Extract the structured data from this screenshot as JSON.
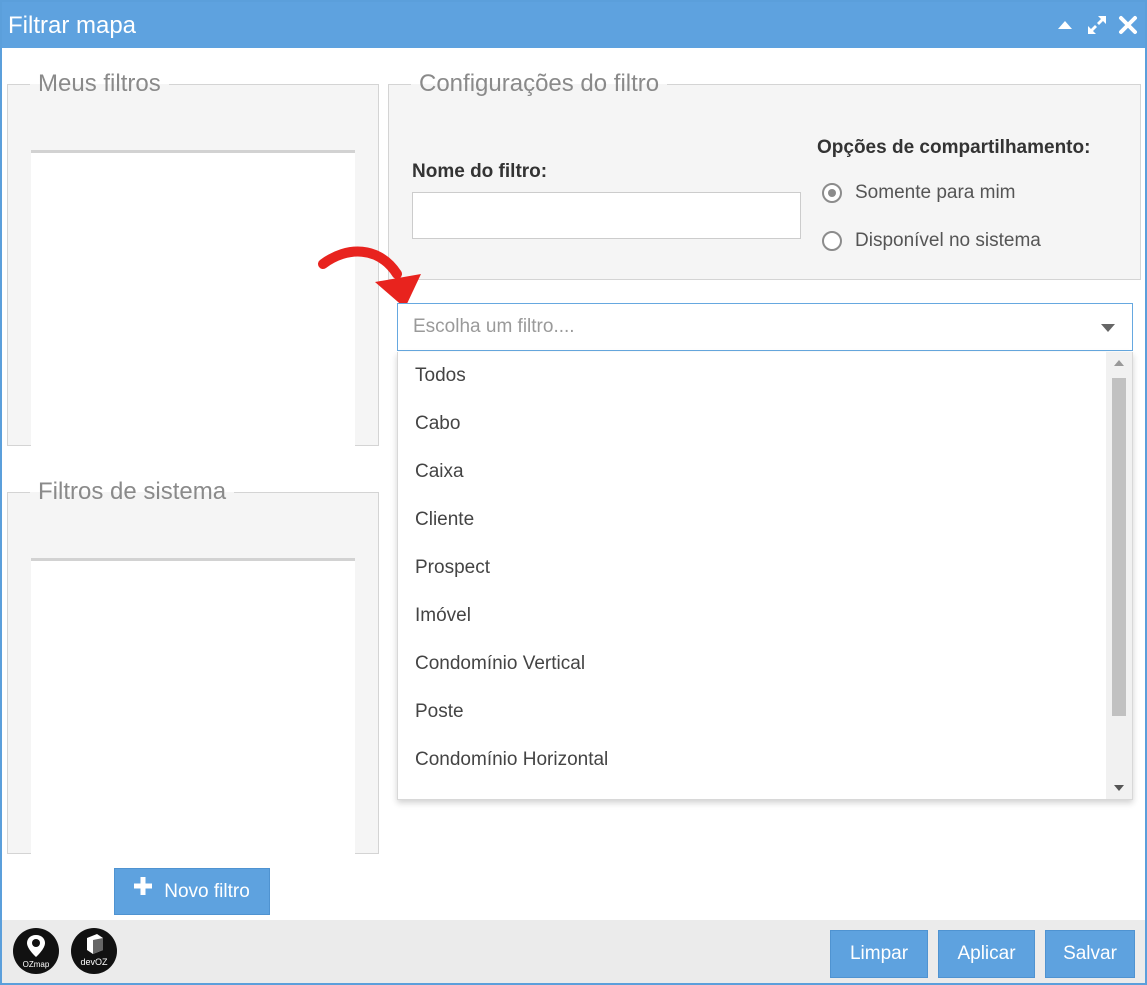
{
  "window": {
    "title": "Filtrar mapa",
    "accent_color": "#5ea2df"
  },
  "titlebar_icons": [
    "collapse-up-icon",
    "expand-arrows-icon",
    "close-icon"
  ],
  "my_filters": {
    "legend": "Meus filtros",
    "items": []
  },
  "system_filters": {
    "legend": "Filtros de sistema",
    "items": []
  },
  "new_filter_button": {
    "label": "Novo filtro",
    "icon": "plus-icon"
  },
  "config": {
    "legend": "Configurações do filtro",
    "name_label": "Nome do filtro:",
    "name_value": "",
    "sharing_label": "Opções de compartilhamento:",
    "sharing_options": [
      {
        "label": "Somente para mim",
        "checked": true
      },
      {
        "label": "Disponível no sistema",
        "checked": false
      }
    ]
  },
  "filter_select": {
    "placeholder": "Escolha um filtro....",
    "options": [
      "Todos",
      "Cabo",
      "Caixa",
      "Cliente",
      "Prospect",
      "Imóvel",
      "Condomínio Vertical",
      "Poste",
      "Condomínio Horizontal"
    ]
  },
  "footer": {
    "logos": [
      {
        "name": "ozmap-logo",
        "text": "OZmap"
      },
      {
        "name": "devoz-logo",
        "text": "devOZ"
      }
    ],
    "buttons": {
      "clear": "Limpar",
      "apply": "Aplicar",
      "save": "Salvar"
    }
  }
}
